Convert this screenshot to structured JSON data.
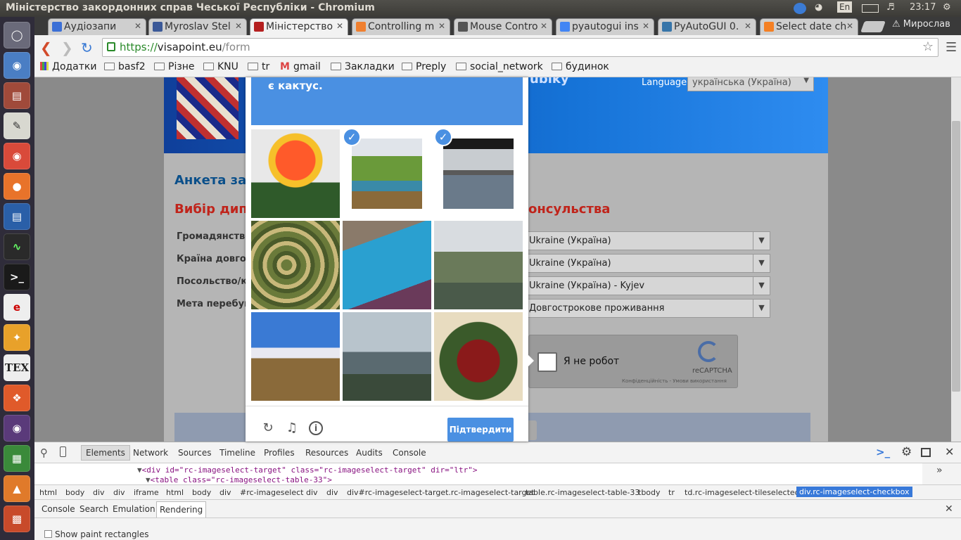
{
  "window": {
    "title": "Міністерство закордонних справ Чеської Республіки - Chromium"
  },
  "tray": {
    "lang": "En",
    "time": "23:17",
    "user": "Мирослав"
  },
  "tabs": [
    {
      "label": "Аудіозапи",
      "color": "#3b6fd6"
    },
    {
      "label": "Myroslav Stel",
      "color": "#3b5998"
    },
    {
      "label": "Міністерство",
      "color": "#b52020"
    },
    {
      "label": "Controlling m",
      "color": "#f08030"
    },
    {
      "label": "Mouse Contro",
      "color": "#555555"
    },
    {
      "label": "pyautogui ins",
      "color": "#4285f4"
    },
    {
      "label": "PyAutoGUI 0.",
      "color": "#3775a9"
    },
    {
      "label": "Select date ch",
      "color": "#f48024"
    }
  ],
  "address": {
    "scheme": "https://",
    "host": "visapoint.eu",
    "path": "/form"
  },
  "bookmarks": [
    "Додатки",
    "basf2",
    "Різне",
    "KNU",
    "tr",
    "gmail",
    "Закладки",
    "Preply",
    "social_network",
    "будинок"
  ],
  "page": {
    "heading_main": "Анкета зая",
    "heading_sub_left": "Вибір дипл",
    "heading_sub_right": "онсульства",
    "banner_partial": "ublky",
    "language_label": "Language:",
    "language_value": "українська (Україна)",
    "fields": [
      {
        "label": "Громадянство",
        "value": "Ukraine (Україна)"
      },
      {
        "label": "Країна довготе",
        "value": "Ukraine (Україна)"
      },
      {
        "label": "Посольство/ко",
        "value": "Ukraine (Україна) - Kyjev"
      },
      {
        "label": "Мета перебуван",
        "value": "Довгострокове проживання"
      }
    ],
    "recaptcha": {
      "label": "Я не робот",
      "brand": "reCAPTCHA",
      "privacy": "Конфіденційність - Умови використання"
    }
  },
  "captcha": {
    "prompt": "є кактус.",
    "verify_label": "Підтвердити",
    "tiles": [
      {
        "name": "cactus-flower",
        "selected": false
      },
      {
        "name": "tropical-garden",
        "selected": true
      },
      {
        "name": "lake-skyline",
        "selected": true
      },
      {
        "name": "cactus-group",
        "selected": false
      },
      {
        "name": "dining-table",
        "selected": false
      },
      {
        "name": "park-trees",
        "selected": false
      },
      {
        "name": "farm-mountain",
        "selected": false
      },
      {
        "name": "coastline",
        "selected": false
      },
      {
        "name": "flower-arrangement",
        "selected": false
      }
    ]
  },
  "devtools": {
    "tabs": [
      "Elements",
      "Network",
      "Sources",
      "Timeline",
      "Profiles",
      "Resources",
      "Audits",
      "Console"
    ],
    "code_line1": "<div id=\"rc-imageselect-target\" class=\"rc-imageselect-target\" dir=\"ltr\">",
    "code_line2": "<table class=\"rc-imageselect-table-33\">",
    "breadcrumbs": [
      "html",
      "body",
      "div",
      "div",
      "iframe",
      "html",
      "body",
      "div",
      "#rc-imageselect",
      "div",
      "div",
      "div#rc-imageselect-target.rc-imageselect-target",
      "table.rc-imageselect-table-33",
      "tbody",
      "tr",
      "td.rc-imageselect-tileselected",
      "div.rc-imageselect-checkbox"
    ],
    "drawer_tabs": [
      "Console",
      "Search",
      "Emulation",
      "Rendering"
    ],
    "paint_option": "Show paint rectangles"
  }
}
